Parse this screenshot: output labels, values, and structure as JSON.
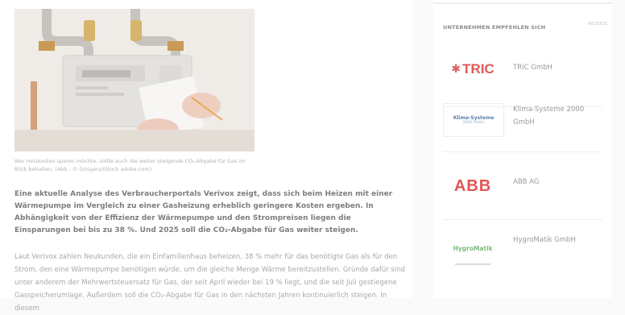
{
  "article": {
    "caption": "Wer Heizkosten sparen möchte, sollte auch die weiter steigende CO₂-Abgabe für Gas im Blick behalten. (Abb.: © Grisgers/iStock adobe.com)",
    "lead": "Eine aktuelle Analyse des Verbraucherportals Verivox zeigt, dass sich beim Heizen mit einer Wärmepumpe im Vergleich zu einer Gasheizung erheblich geringere Kosten ergeben. In Abhängigkeit von der Effizienz der Wärmepumpe und den Strompreisen liegen die Einsparungen bei bis zu 38 %. Und 2025 soll die CO₂-Abgabe für Gas weiter steigen.",
    "body": "Laut Verivox zahlen Neukunden, die ein Einfamilienhaus beheizen, 38 % mehr für das benötigte Gas als für den Strom, den eine Wärmepumpe benötigen würde, um die gleiche Menge Wärme bereitzustellen. Gründe dafür sind unter anderem der Mehrwertsteuersatz für Gas, der seit April wieder bei 19 % liegt, und die seit Juli gestiegene Gasspeicherumlage. Außerdem soll die CO₂-Abgabe für Gas in den nächsten Jahren kontinuierlich steigen. In diesem"
  },
  "sidebar": {
    "title": "UNTERNEHMEN EMPFEHLEN SICH",
    "ad_tag": "ANZEIGE",
    "companies": [
      {
        "name": "TRIC GmbH",
        "logo_text": "TRIC",
        "logo_color": "#e05a5a"
      },
      {
        "name": "Klima-Systeme 2000 GmbH",
        "logo_text": "Klima-Systeme",
        "logo_sub": "2000 GmbH",
        "logo_color": "#5a7fb0"
      },
      {
        "name": "ABB AG",
        "logo_text": "ABB",
        "logo_color": "#e25555"
      },
      {
        "name": "HygroMatik GmbH",
        "logo_text": "HygroMatik",
        "logo_color": "#7dbb7d"
      }
    ]
  },
  "colors": {
    "accent_red": "#e05a5a",
    "text_muted": "#a8a8a8"
  }
}
